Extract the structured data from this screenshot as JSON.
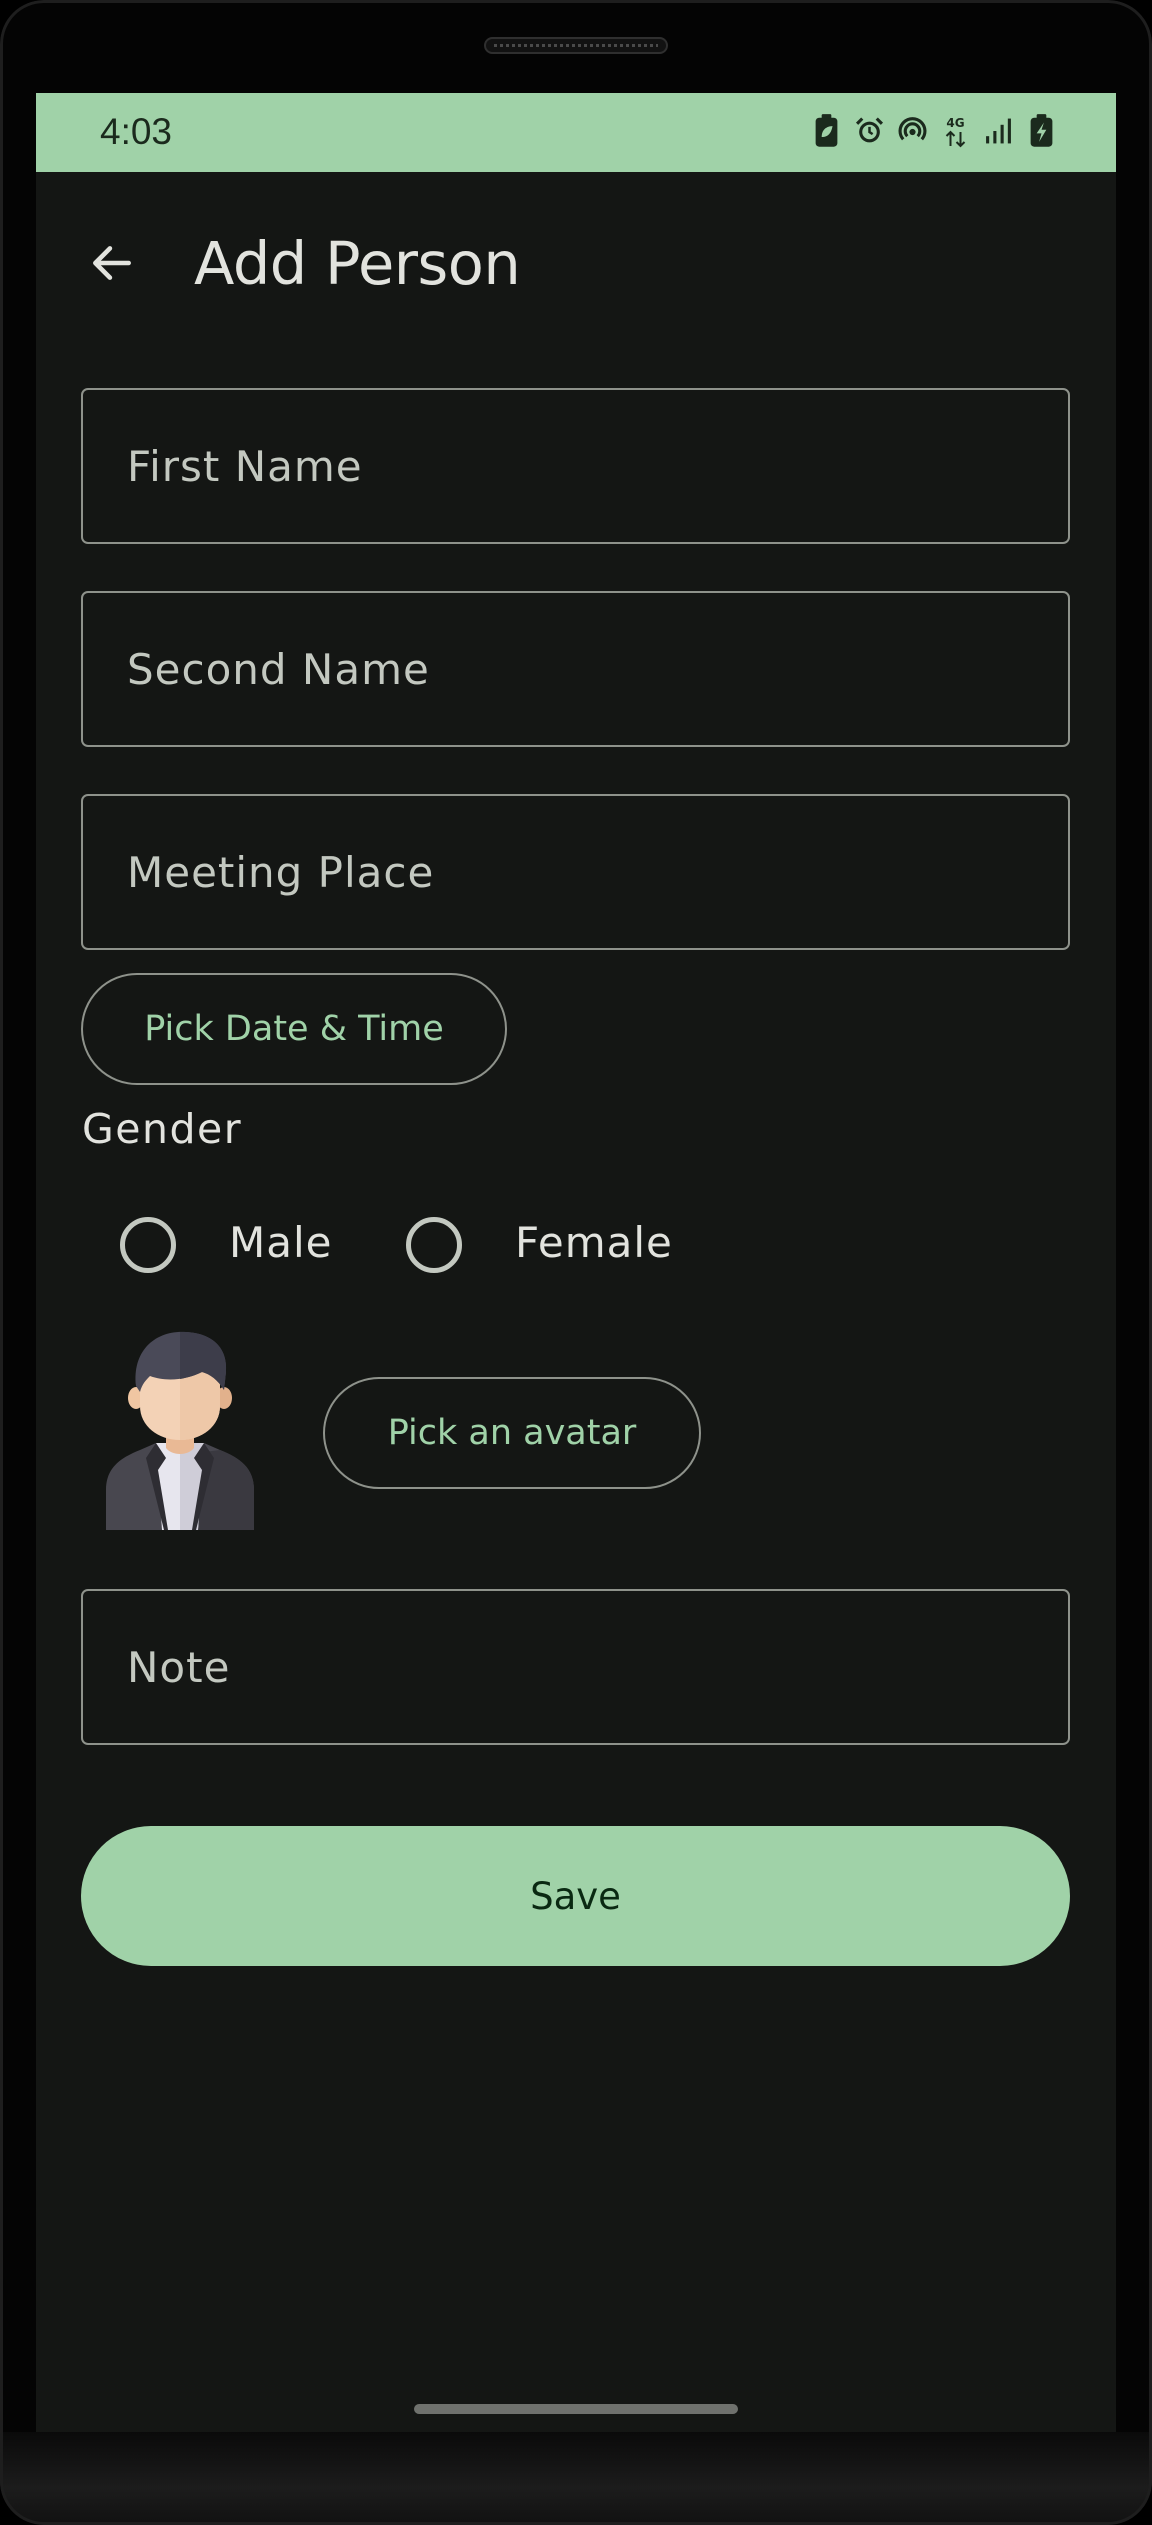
{
  "status_bar": {
    "time": "4:03",
    "icons": [
      "battery-saver-icon",
      "alarm-icon",
      "hotspot-icon",
      "4g-icon",
      "signal-icon",
      "battery-charging-icon"
    ],
    "network_label": "4G"
  },
  "app_bar": {
    "title": "Add Person",
    "back_icon": "arrow-back-icon"
  },
  "form": {
    "first_name": {
      "placeholder": "First Name",
      "value": ""
    },
    "second_name": {
      "placeholder": "Second Name",
      "value": ""
    },
    "meeting_place": {
      "placeholder": "Meeting Place",
      "value": ""
    },
    "pick_date_time_label": "Pick Date & Time",
    "gender": {
      "label": "Gender",
      "options": [
        "Male",
        "Female"
      ],
      "selected": null
    },
    "avatar": {
      "icon": "businessman-avatar-icon",
      "pick_label": "Pick an avatar"
    },
    "note": {
      "placeholder": "Note",
      "value": ""
    },
    "save_label": "Save"
  },
  "colors": {
    "accent": "#a0d2a8",
    "background": "#141614",
    "outline": "#8e928b",
    "on_surface": "#e2e3de",
    "on_surface_variant": "#c3c8c0",
    "on_primary": "#0a2912"
  }
}
